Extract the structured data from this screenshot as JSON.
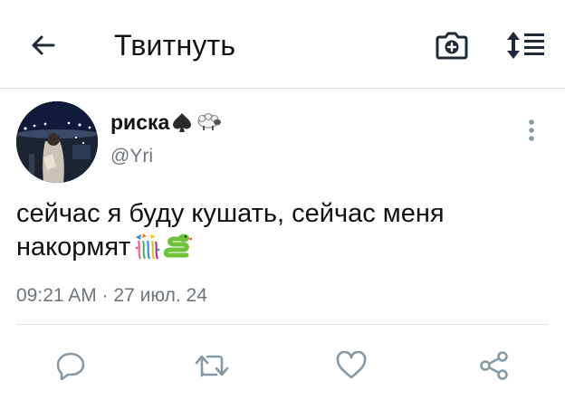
{
  "header": {
    "title": "Твитнуть",
    "back_icon": "arrow-left-icon",
    "camera_icon": "camera-add-icon",
    "sort_icon": "sort-list-icon"
  },
  "tweet": {
    "user_name": "риска",
    "name_emojis": [
      "spade-suit",
      "sheep"
    ],
    "handle": "@Yri",
    "text": "сейчас я буду кушать, сейчас меня накормят",
    "text_emojis": [
      "confetti-ball",
      "snake"
    ],
    "time": "09:21 AM",
    "separator": "·",
    "date": "27 июл. 24"
  },
  "actions": [
    {
      "name": "reply",
      "icon": "reply-bubble-icon"
    },
    {
      "name": "retweet",
      "icon": "retweet-icon"
    },
    {
      "name": "like",
      "icon": "heart-icon"
    },
    {
      "name": "share",
      "icon": "share-icon"
    }
  ],
  "colors": {
    "text": "#111111",
    "muted": "#6e767d",
    "icon": "#1f2a36",
    "action_icon": "#8899a6",
    "divider": "#dcdcdc"
  }
}
